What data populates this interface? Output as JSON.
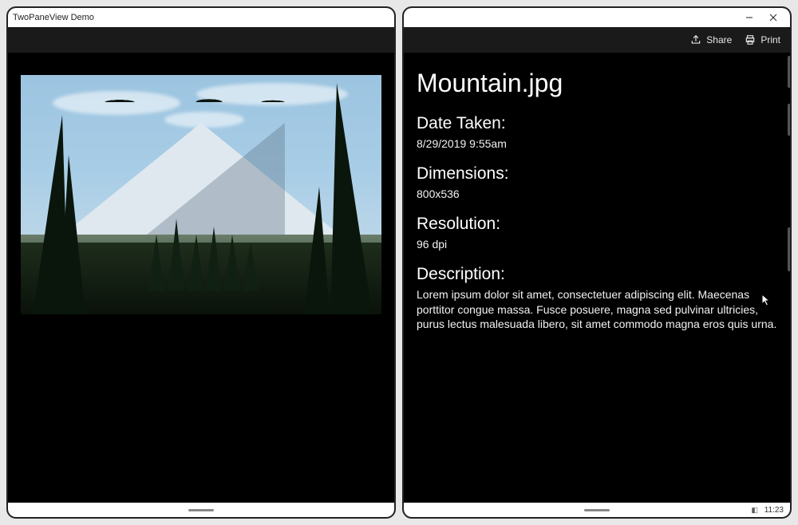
{
  "window": {
    "title": "TwoPaneView Demo",
    "minimize_glyph": "—",
    "close_glyph": "✕"
  },
  "toolbar": {
    "share_label": "Share",
    "print_label": "Print"
  },
  "image": {
    "alt": "Photograph of a snow-covered mountain framed by evergreen trees"
  },
  "details": {
    "title": "Mountain.jpg",
    "date_label": "Date Taken:",
    "date_value": "8/29/2019 9:55am",
    "dimensions_label": "Dimensions:",
    "dimensions_value": "800x536",
    "resolution_label": "Resolution:",
    "resolution_value": "96 dpi",
    "description_label": "Description:",
    "description_value": "Lorem ipsum dolor sit amet, consectetuer adipiscing elit. Maecenas porttitor congue massa. Fusce posuere, magna sed pulvinar ultricies, purus lectus malesuada libero, sit amet commodo magna eros quis urna."
  },
  "taskbar": {
    "clock": "11:23"
  }
}
